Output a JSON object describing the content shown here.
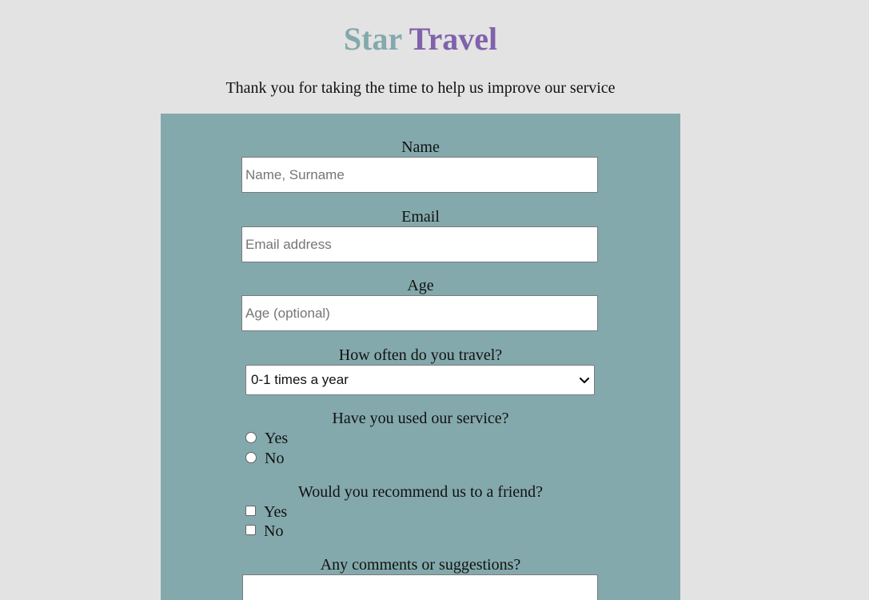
{
  "header": {
    "title_part1": "Star",
    "title_part2": "Travel",
    "subtitle": "Thank you for taking the time to help us improve our service"
  },
  "form": {
    "name": {
      "label": "Name",
      "placeholder": "Name, Surname",
      "value": ""
    },
    "email": {
      "label": "Email",
      "placeholder": "Email address",
      "value": ""
    },
    "age": {
      "label": "Age",
      "placeholder": "Age (optional)",
      "value": ""
    },
    "travel_frequency": {
      "label": "How often do you travel?",
      "selected": "0-1 times a year",
      "icon": "chevron-down-icon"
    },
    "used_service": {
      "label": "Have you used our service?",
      "options": [
        "Yes",
        "No"
      ]
    },
    "recommend": {
      "label": "Would you recommend us to a friend?",
      "options": [
        "Yes",
        "No"
      ]
    },
    "comments": {
      "label": "Any comments or suggestions?",
      "value": ""
    }
  },
  "colors": {
    "page_bg": "#e3e3e3",
    "panel_bg": "#84a9ac",
    "title_part1": "#84a9ac",
    "title_part2": "#8062ab"
  }
}
